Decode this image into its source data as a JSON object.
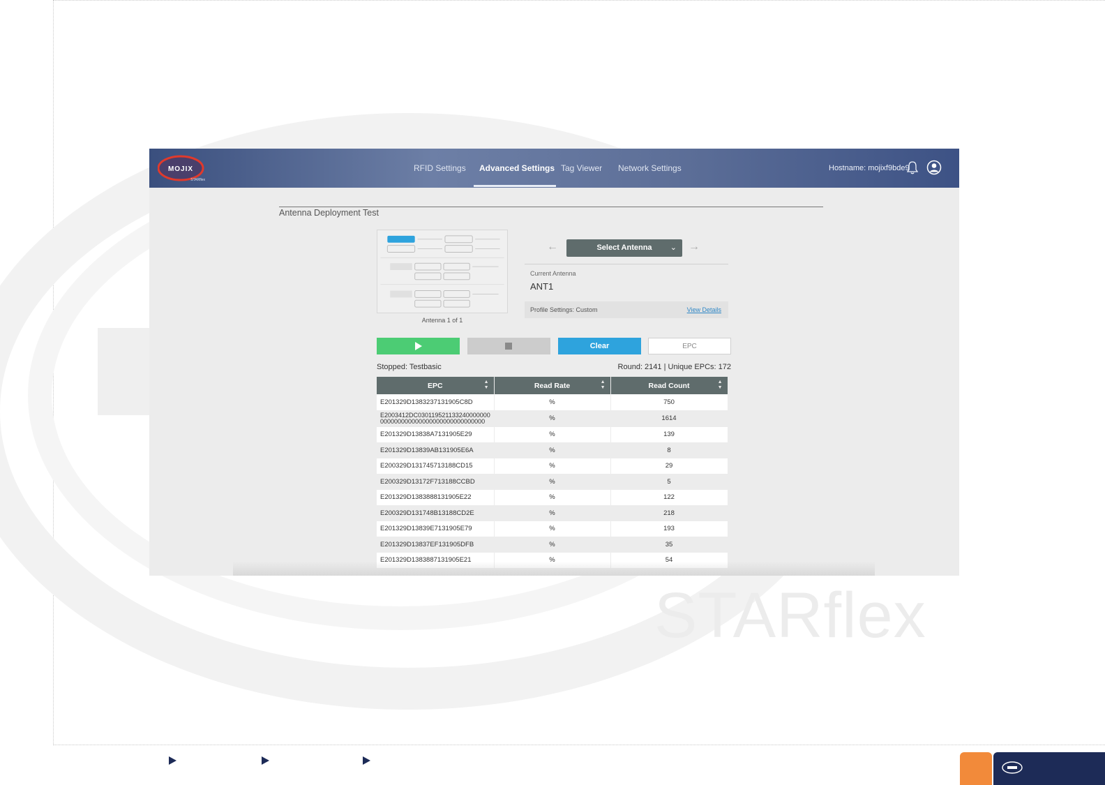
{
  "watermark": {
    "brand_text": "STARflex"
  },
  "header": {
    "logo_text": "MOJIX",
    "logo_sub": "STARflex",
    "nav": [
      {
        "label": "RFID Settings",
        "active": false
      },
      {
        "label": "Advanced Settings",
        "active": true
      },
      {
        "label": "Tag Viewer",
        "active": false
      },
      {
        "label": "Network Settings",
        "active": false
      }
    ],
    "hostname": "Hostname: mojixf9bde9"
  },
  "page": {
    "title": "Antenna Deployment Test",
    "antenna_count": "Antenna 1 of 1",
    "select_antenna_label": "Select Antenna",
    "current_antenna_label": "Current Antenna",
    "current_antenna_value": "ANT1",
    "profile_settings": "Profile Settings: Custom",
    "view_details": "View Details",
    "clear_label": "Clear",
    "epc_placeholder": "EPC",
    "status_left": "Stopped: Testbasic",
    "status_right": "Round: 2141 | Unique EPCs: 172"
  },
  "table": {
    "headers": [
      "EPC",
      "Read Rate",
      "Read Count"
    ],
    "rows": [
      {
        "epc": "E201329D1383237131905C8D",
        "rate": "%",
        "count": "750"
      },
      {
        "epc": "E2003412DC030119521133240000000000000000000000000000000000000",
        "rate": "%",
        "count": "1614"
      },
      {
        "epc": "E201329D13838A7131905E29",
        "rate": "%",
        "count": "139"
      },
      {
        "epc": "E201329D13839AB131905E6A",
        "rate": "%",
        "count": "8"
      },
      {
        "epc": "E200329D131745713188CD15",
        "rate": "%",
        "count": "29"
      },
      {
        "epc": "E200329D13172F713188CCBD",
        "rate": "%",
        "count": "5"
      },
      {
        "epc": "E201329D1383888131905E22",
        "rate": "%",
        "count": "122"
      },
      {
        "epc": "E200329D131748B13188CD2E",
        "rate": "%",
        "count": "218"
      },
      {
        "epc": "E201329D13839E7131905E79",
        "rate": "%",
        "count": "193"
      },
      {
        "epc": "E201329D13837EF131905DFB",
        "rate": "%",
        "count": "35"
      },
      {
        "epc": "E201329D1383887131905E21",
        "rate": "%",
        "count": "54"
      }
    ]
  },
  "colors": {
    "header_bg": "#4a5f8f",
    "play_green": "#4ccc74",
    "clear_blue": "#2ea3dd",
    "table_header": "#5f6c6c",
    "footer_orange": "#f28a3a",
    "footer_navy": "#1d2b57"
  },
  "icons": [
    "bell-icon",
    "user-icon",
    "play-icon",
    "stop-icon",
    "arrow-left-icon",
    "arrow-right-icon",
    "chevron-down-icon",
    "sort-icon"
  ]
}
